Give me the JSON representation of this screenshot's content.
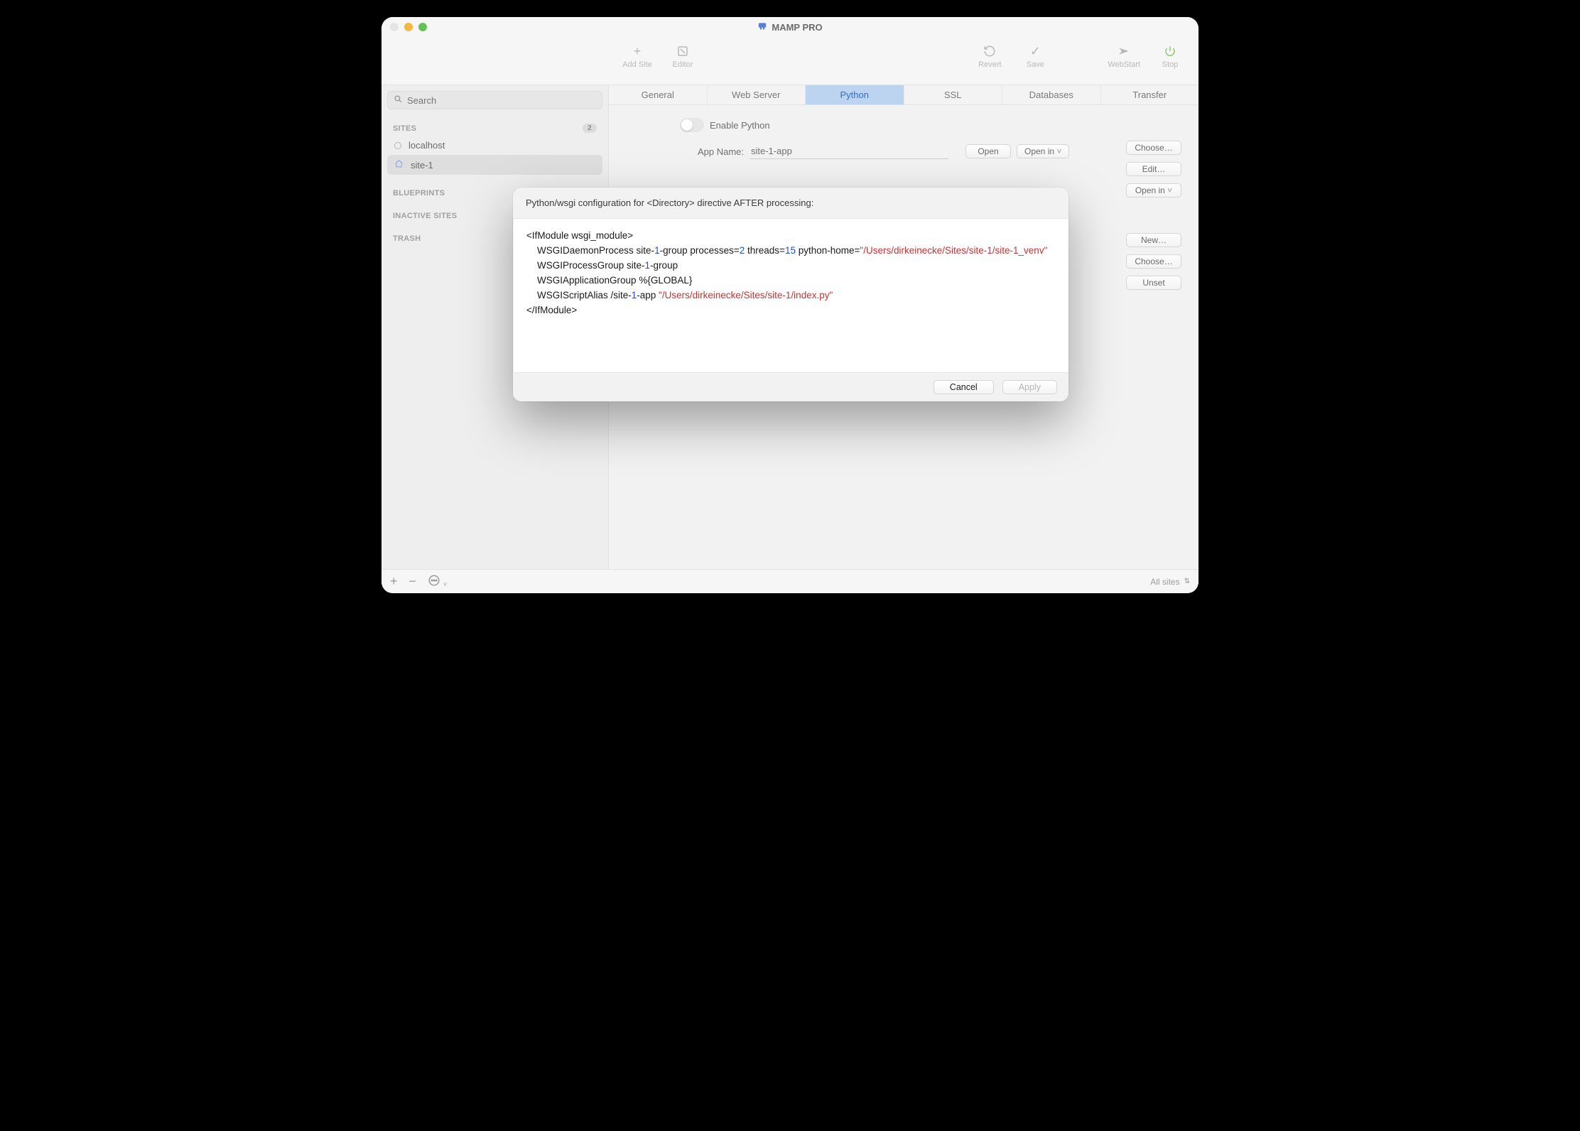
{
  "app": {
    "title": "MAMP PRO"
  },
  "toolbar": {
    "addSite": "Add Site",
    "editor": "Editor",
    "revert": "Revert",
    "save": "Save",
    "webstart": "WebStart",
    "stop": "Stop"
  },
  "search": {
    "placeholder": "Search"
  },
  "sidebar": {
    "sections": {
      "sites": {
        "label": "SITES",
        "count": "2"
      },
      "blueprints": "BLUEPRINTS",
      "inactive": "INACTIVE SITES",
      "trash": "TRASH"
    },
    "items": [
      {
        "label": "localhost"
      },
      {
        "label": "site-1"
      }
    ]
  },
  "tabs": [
    "General",
    "Web Server",
    "Python",
    "SSL",
    "Databases",
    "Transfer"
  ],
  "activeTab": "Python",
  "python": {
    "enableLabel": "Enable Python",
    "appNameLabel": "App Name:",
    "appName": "site-1-app",
    "openBtn": "Open",
    "openInBtn": "Open in"
  },
  "sideButtons": {
    "choose1": "Choose…",
    "edit": "Edit…",
    "openIn": "Open in",
    "new": "New…",
    "choose2": "Choose…",
    "unset": "Unset"
  },
  "statusbar": {
    "allSites": "All sites"
  },
  "modal": {
    "title": "Python/wsgi configuration for <Directory> directive AFTER processing:",
    "cancel": "Cancel",
    "apply": "Apply",
    "config": {
      "ifModuleOpen": "<IfModule wsgi_module>",
      "daemon_pre": "    WSGIDaemonProcess site-",
      "daemon_n1": "1",
      "daemon_mid1": "-group processes=",
      "daemon_n2": "2",
      "daemon_mid2": " threads=",
      "daemon_n3": "15",
      "daemon_mid3": " python-home=",
      "daemon_path": "\"/Users/dirkeinecke/Sites/site-1/site-1_venv\"",
      "procgroup_pre": "    WSGIProcessGroup site-",
      "procgroup_n": "1",
      "procgroup_post": "-group",
      "appgroup": "    WSGIApplicationGroup %{GLOBAL}",
      "alias_pre": "    WSGIScriptAlias /site-",
      "alias_n": "1",
      "alias_mid": "-app ",
      "alias_path": "\"/Users/dirkeinecke/Sites/site-1/index.py\"",
      "ifModuleClose": "</IfModule>"
    }
  }
}
